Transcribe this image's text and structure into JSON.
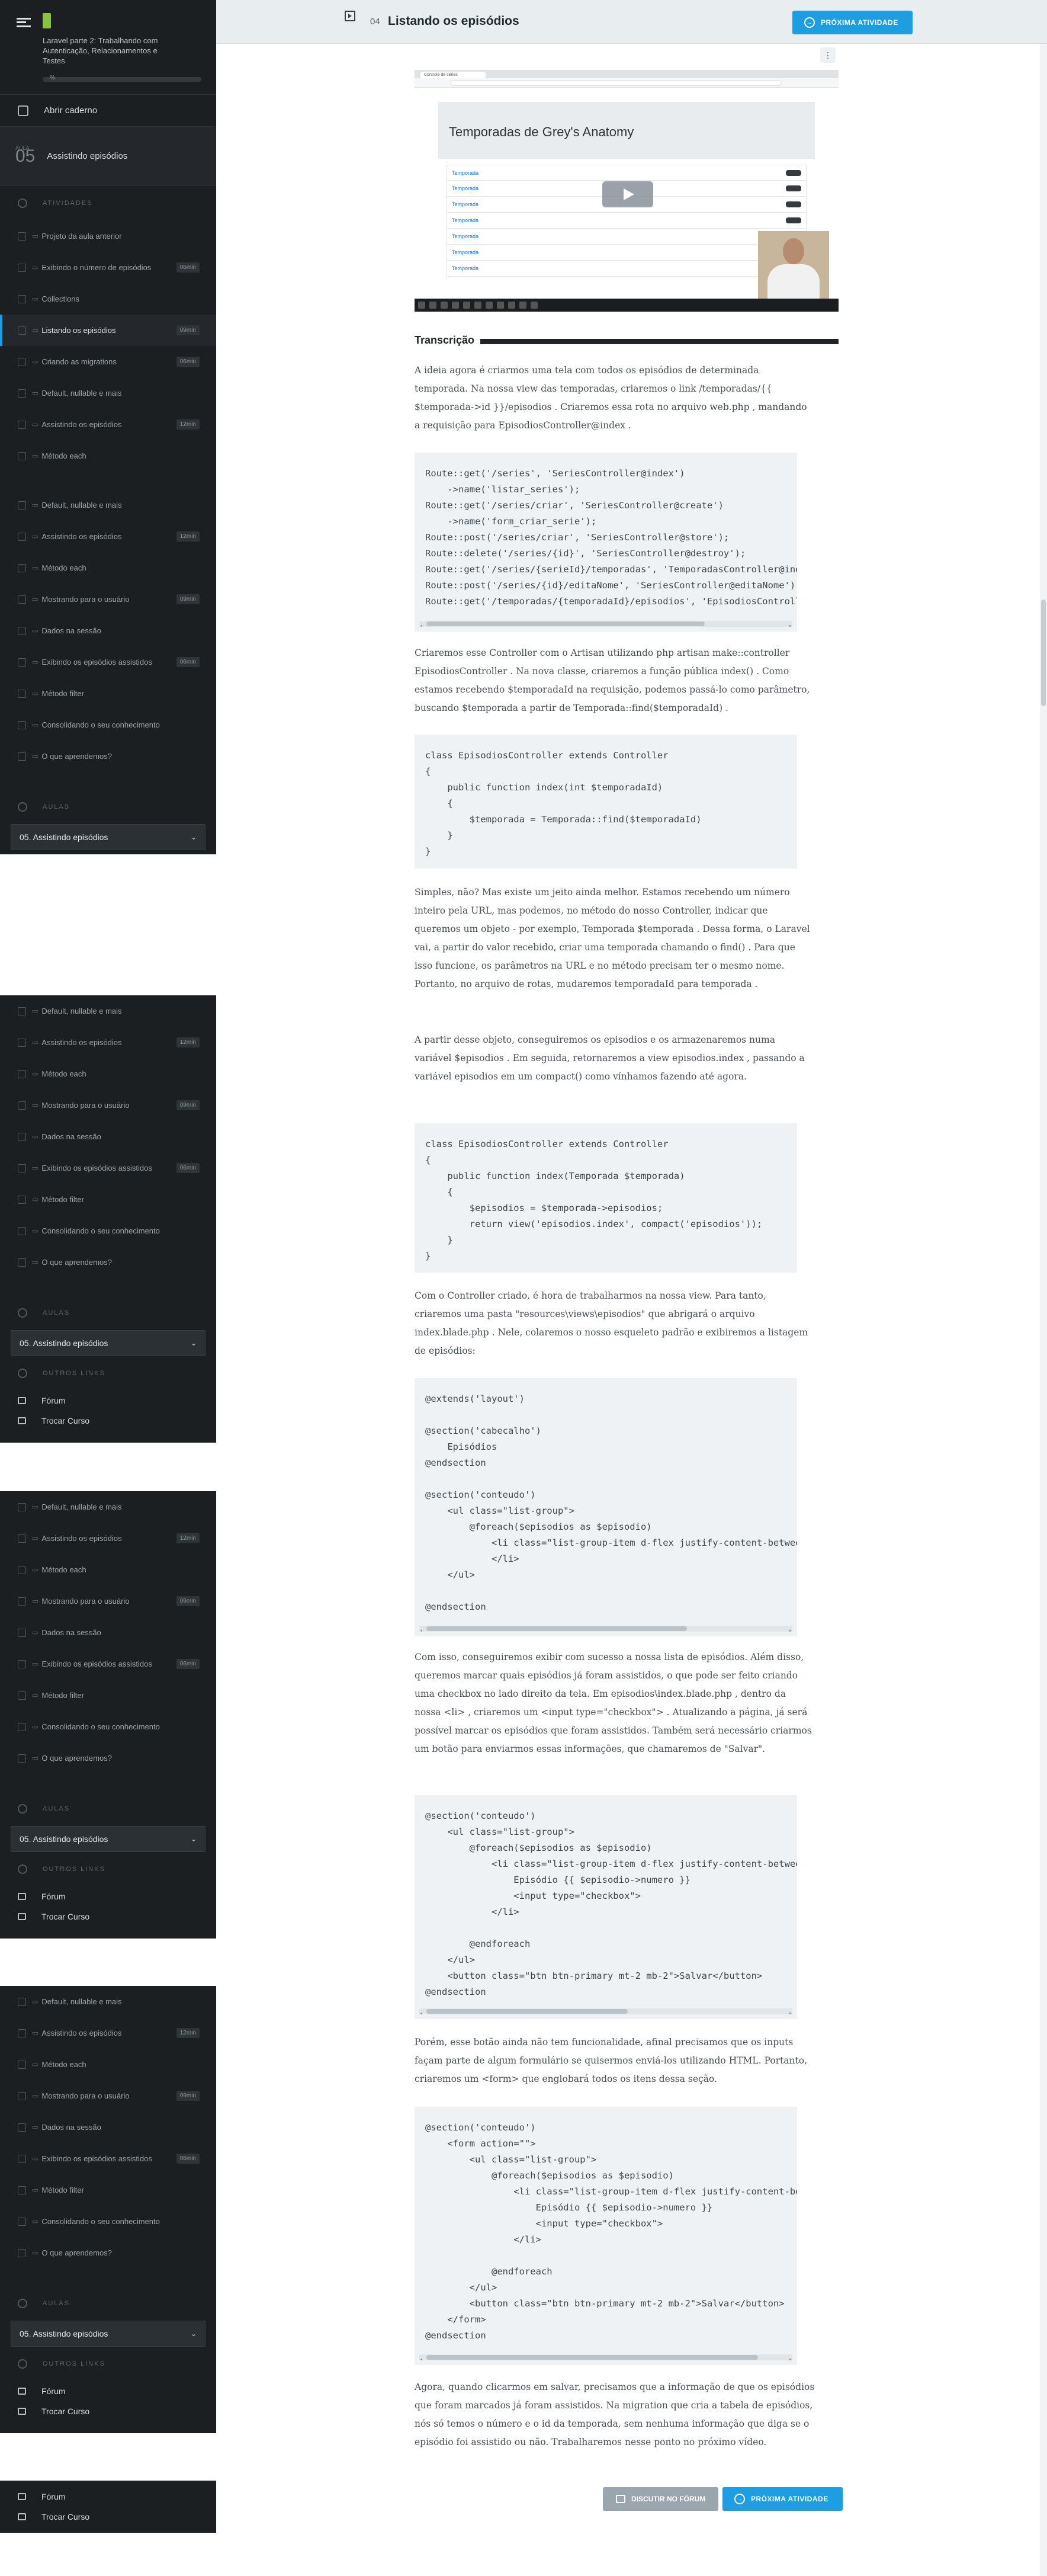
{
  "header": {
    "lesson_number": "04",
    "lesson_title": "Listando os episódios",
    "next_label": "PRÓXIMA ATIVIDADE"
  },
  "sidebar": {
    "course_title": "Laravel parte 2: Trabalhando com Autenticação, Relacionamentos e Testes",
    "progress_label": "%",
    "notebook_label": "Abrir caderno",
    "lesson_label_small": "AULA",
    "lesson_number": "05",
    "lesson_title": "Assistindo episódios",
    "activities_heading": "ATIVIDADES",
    "classes_heading": "AULAS",
    "selected_class": "05. Assistindo episódios",
    "other_links_heading": "OUTROS LINKS",
    "forum_label": "Fórum",
    "change_course_label": "Trocar Curso",
    "activities": [
      {
        "label": "Projeto da aula anterior",
        "dur": ""
      },
      {
        "label": "Exibindo o número de episódios",
        "dur": "06min"
      },
      {
        "label": "Collections",
        "dur": ""
      },
      {
        "label": "Listando os episódios",
        "dur": "09min"
      },
      {
        "label": "Criando as migrations",
        "dur": "06min"
      },
      {
        "label": "Default, nullable e mais",
        "dur": ""
      },
      {
        "label": "Assistindo os episódios",
        "dur": "12min"
      },
      {
        "label": "Método each",
        "dur": ""
      },
      {
        "label": "Default, nullable e mais",
        "dur": ""
      },
      {
        "label": "Assistindo os episódios",
        "dur": "12min"
      },
      {
        "label": "Método each",
        "dur": ""
      },
      {
        "label": "Mostrando para o usuário",
        "dur": "09min"
      },
      {
        "label": "Dados na sessão",
        "dur": ""
      },
      {
        "label": "Exibindo os episódios assistidos",
        "dur": "06min"
      },
      {
        "label": "Método filter",
        "dur": ""
      },
      {
        "label": "Consolidando o seu conhecimento",
        "dur": ""
      },
      {
        "label": "O que aprendemos?",
        "dur": ""
      }
    ],
    "repeat": [
      {
        "label": "Default, nullable e mais",
        "dur": ""
      },
      {
        "label": "Assistindo os episódios",
        "dur": "12min"
      },
      {
        "label": "Método each",
        "dur": ""
      },
      {
        "label": "Mostrando para o usuário",
        "dur": "09min"
      },
      {
        "label": "Dados na sessão",
        "dur": ""
      },
      {
        "label": "Exibindo os episódios assistidos",
        "dur": "06min"
      },
      {
        "label": "Método filter",
        "dur": ""
      },
      {
        "label": "Consolidando o seu conhecimento",
        "dur": ""
      },
      {
        "label": "O que aprendemos?",
        "dur": ""
      }
    ]
  },
  "video": {
    "tab_label": "Controle de séries",
    "page_heading": "Temporadas de Grey's Anatomy",
    "season_label": "Temporada"
  },
  "transcript": {
    "heading": "Transcrição",
    "p1": "A ideia agora é criarmos uma tela com todos os episódios de determinada temporada. Na nossa view das temporadas, criaremos o link /temporadas/{{ $temporada->id }}/episodios . Criaremos essa rota no arquivo web.php , mandando a requisição para EpisodiosController@index .",
    "p2": "Criaremos esse Controller com o Artisan utilizando php artisan make::controller EpisodiosController . Na nova classe, criaremos a função pública index() . Como estamos recebendo $temporadaId na requisição, podemos passá-lo como parâmetro, buscando $temporada a partir de Temporada::find($temporadaId) .",
    "p3": "Simples, não? Mas existe um jeito ainda melhor. Estamos recebendo um número inteiro pela URL, mas podemos, no método do nosso Controller, indicar que queremos um objeto - por exemplo, Temporada $temporada . Dessa forma, o Laravel vai, a partir do valor recebido, criar uma temporada chamando o find() . Para que isso funcione, os parâmetros na URL e no método precisam ter o mesmo nome. Portanto, no arquivo de rotas, mudaremos temporadaId para temporada .",
    "p4": "A partir desse objeto, conseguiremos os episodios e os armazenaremos numa variável $episodios . Em seguida, retornaremos a view episodios.index , passando a variável episodios em um compact() como vínhamos fazendo até agora.",
    "p5": "Com o Controller criado, é hora de trabalharmos na nossa view. Para tanto, criaremos uma pasta \"resources\\views\\episodios\" que abrigará o arquivo index.blade.php . Nele, colaremos o nosso esqueleto padrão e exibiremos a listagem de episódios:",
    "p6": "Com isso, conseguiremos exibir com sucesso a nossa lista de episódios. Além disso, queremos marcar quais episódios já foram assistidos, o que pode ser feito criando uma checkbox no lado direito da tela. Em episodios\\index.blade.php , dentro da nossa <li> , criaremos um <input type=\"checkbox\"> . Atualizando a página, já será possível marcar os episódios que foram assistidos. Também será necessário criarmos um botão para enviarmos essas informações, que chamaremos de \"Salvar\".",
    "p7": "Porém, esse botão ainda não tem funcionalidade, afinal precisamos que os inputs façam parte de algum formulário se quisermos enviá-los utilizando HTML. Portanto, criaremos um <form> que englobará todos os itens dessa seção.",
    "p8": "Agora, quando clicarmos em salvar, precisamos que a informação de que os episódios que foram marcados já foram assistidos. Na migration que cria a tabela de episódios, nós só temos o número e o id da temporada, sem nenhuma informação que diga se o episódio foi assistido ou não. Trabalharemos nesse ponto no próximo vídeo."
  },
  "code": {
    "c1": "Route::get('/series', 'SeriesController@index')\n    ->name('listar_series');\nRoute::get('/series/criar', 'SeriesController@create')\n    ->name('form_criar_serie');\nRoute::post('/series/criar', 'SeriesController@store');\nRoute::delete('/series/{id}', 'SeriesController@destroy');\nRoute::get('/series/{serieId}/temporadas', 'TemporadasController@index');\nRoute::post('/series/{id}/editaNome', 'SeriesController@editaNome');\nRoute::get('/temporadas/{temporadaId}/episodios', 'EpisodiosController@index');",
    "c2": "class EpisodiosController extends Controller\n{\n    public function index(int $temporadaId)\n    {\n        $temporada = Temporada::find($temporadaId)\n    }\n}",
    "c3": "class EpisodiosController extends Controller\n{\n    public function index(Temporada $temporada)\n    {\n        $episodios = $temporada->episodios;\n        return view('episodios.index', compact('episodios'));\n    }\n}",
    "c4": "@extends('layout')\n\n@section('cabecalho')\n    Episódios\n@endsection\n\n@section('conteudo')\n    <ul class=\"list-group\">\n        @foreach($episodios as $episodio)\n            <li class=\"list-group-item d-flex justify-content-between align-items-center\">\n            </li>\n    </ul>\n\n@endsection",
    "c5": "@section('conteudo')\n    <ul class=\"list-group\">\n        @foreach($episodios as $episodio)\n            <li class=\"list-group-item d-flex justify-content-between align-items-center\">\n                Episódio {{ $episodio->numero }}\n                <input type=\"checkbox\">\n            </li>\n\n        @endforeach\n    </ul>\n    <button class=\"btn btn-primary mt-2 mb-2\">Salvar</button>\n@endsection",
    "c6": "@section('conteudo')\n    <form action=\"\">\n        <ul class=\"list-group\">\n            @foreach($episodios as $episodio)\n                <li class=\"list-group-item d-flex justify-content-between align-items-center\">\n                    Episódio {{ $episodio->numero }}\n                    <input type=\"checkbox\">\n                </li>\n\n            @endforeach\n        </ul>\n        <button class=\"btn btn-primary mt-2 mb-2\">Salvar</button>\n    </form>\n@endsection"
  },
  "footer": {
    "forum_button": "DISCUTIR NO FÓRUM",
    "next_button": "PRÓXIMA ATIVIDADE"
  }
}
